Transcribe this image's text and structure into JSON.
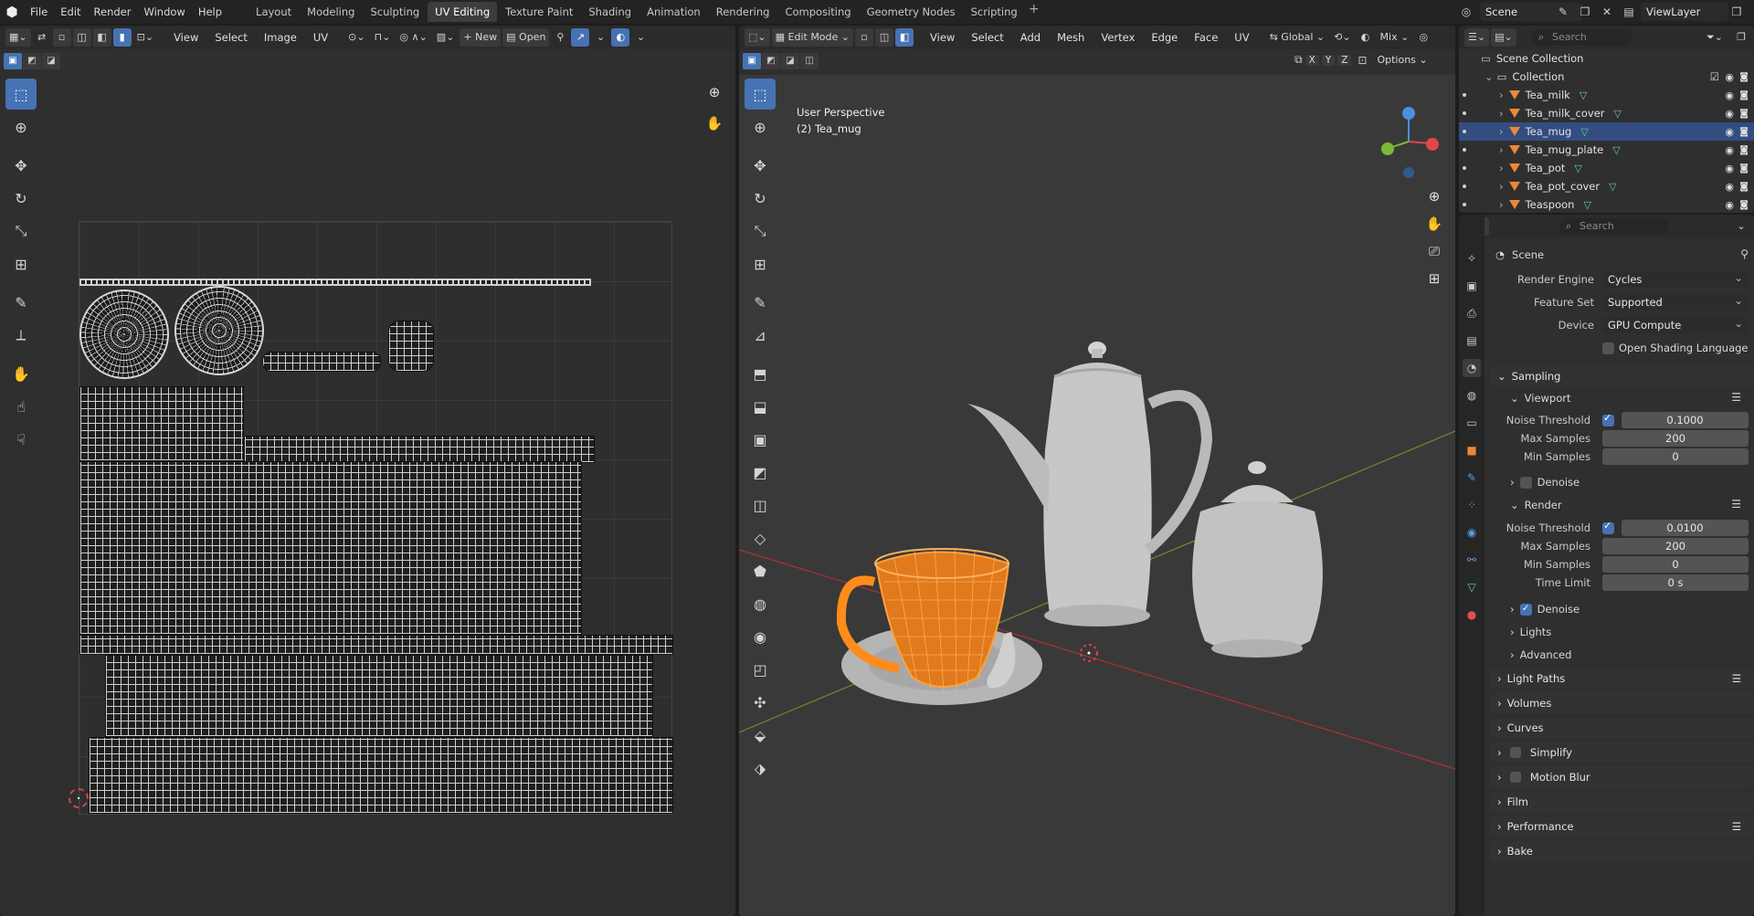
{
  "topbar": {
    "menus": [
      "File",
      "Edit",
      "Render",
      "Window",
      "Help"
    ],
    "workspaces": [
      "Layout",
      "Modeling",
      "Sculpting",
      "UV Editing",
      "Texture Paint",
      "Shading",
      "Animation",
      "Rendering",
      "Compositing",
      "Geometry Nodes",
      "Scripting"
    ],
    "active_workspace": "UV Editing",
    "scene": "Scene",
    "view_layer": "ViewLayer"
  },
  "uv_editor": {
    "menus": [
      "View",
      "Select",
      "Image",
      "UV"
    ],
    "new_label": "New",
    "open_label": "Open"
  },
  "viewport": {
    "mode": "Edit Mode",
    "menus": [
      "View",
      "Select",
      "Add",
      "Mesh",
      "Vertex",
      "Edge",
      "Face",
      "UV"
    ],
    "orientation": "Global",
    "shading_mix": "Mix",
    "options_label": "Options",
    "axes": [
      "X",
      "Y",
      "Z"
    ],
    "info_line1": "User Perspective",
    "info_line2": "(2) Tea_mug"
  },
  "outliner": {
    "search_placeholder": "Search",
    "scene_collection": "Scene Collection",
    "collection": "Collection",
    "objects": [
      "Tea_milk",
      "Tea_milk_cover",
      "Tea_mug",
      "Tea_mug_plate",
      "Tea_pot",
      "Tea_pot_cover",
      "Teaspoon"
    ],
    "selected": "Tea_mug"
  },
  "properties": {
    "search_placeholder": "Search",
    "context": "Scene",
    "render_engine_label": "Render Engine",
    "render_engine": "Cycles",
    "feature_set_label": "Feature Set",
    "feature_set": "Supported",
    "device_label": "Device",
    "device": "GPU Compute",
    "osl_label": "Open Shading Language",
    "sampling": "Sampling",
    "viewport": "Viewport",
    "noise_threshold_label": "Noise Threshold",
    "viewport_noise": "0.1000",
    "max_samples_label": "Max Samples",
    "viewport_max": "200",
    "min_samples_label": "Min Samples",
    "viewport_min": "0",
    "denoise_label": "Denoise",
    "render": "Render",
    "render_noise": "0.0100",
    "render_max": "200",
    "render_min": "0",
    "time_limit_label": "Time Limit",
    "time_limit": "0 s",
    "lights": "Lights",
    "advanced": "Advanced",
    "light_paths": "Light Paths",
    "volumes": "Volumes",
    "curves": "Curves",
    "simplify": "Simplify",
    "motion_blur": "Motion Blur",
    "film": "Film",
    "performance": "Performance",
    "bake": "Bake"
  },
  "colors": {
    "accent": "#4772b3",
    "selection_orange": "#ff8c1a",
    "mesh_icon": "#5fd39c",
    "object_icon": "#e8893a"
  }
}
